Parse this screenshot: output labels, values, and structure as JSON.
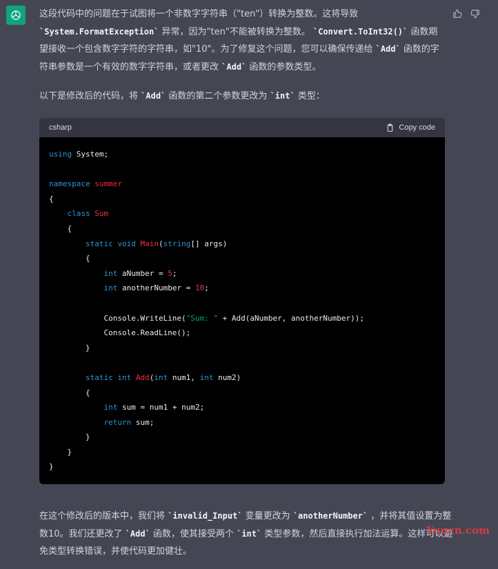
{
  "intro": {
    "t1": "这段代码中的问题在于试图将一个非数字字符串（\"ten\"）转换为整数。这将导致",
    "t2": "`System.FormatException`",
    "t3": "异常，因为\"ten\"不能被转换为整数。",
    "t4": "`Convert.ToInt32()`",
    "t5": "函数期望接收一个包含数字字符的字符串，如\"10\"。为了修复这个问题，您可以确保传递给",
    "t6": "`Add`",
    "t7": "函数的字符串参数是一个有效的数字字符串，或者更改",
    "t8": "`Add`",
    "t9": "函数的参数类型。"
  },
  "para2": {
    "t1": "以下是修改后的代码，将",
    "t2": "`Add`",
    "t3": "函数的第二个参数更改为",
    "t4": "`int`",
    "t5": "类型："
  },
  "code": {
    "language": "csharp",
    "copy_label": "Copy code"
  },
  "outro": {
    "t1": "在这个修改后的版本中，我们将",
    "t2": "`invalid_Input`",
    "t3": "变量更改为",
    "t4": "`anotherNumber`",
    "t5": "，并将其值设置为整数10。我们还更改了",
    "t6": "`Add`",
    "t7": "函数，使其接受两个",
    "t8": "`int`",
    "t9": "类型参数，然后直接执行加法运算。这样可以避免类型转换错误，并使代码更加健壮。"
  },
  "watermark": "Yuucn.com",
  "icons": {
    "avatar": "openai-logo-icon",
    "like": "thumbs-up-icon",
    "dislike": "thumbs-down-icon",
    "copy": "clipboard-icon"
  },
  "colors": {
    "background": "#444654",
    "code_bg": "#000000",
    "code_header": "#343541",
    "avatar": "#10a37f"
  }
}
